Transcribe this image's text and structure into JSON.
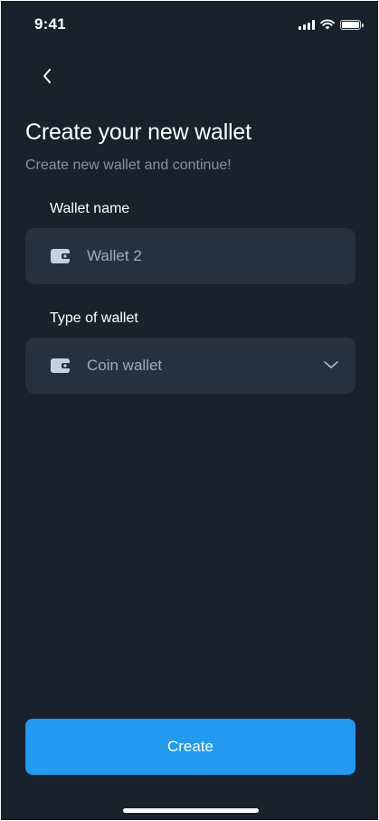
{
  "status_bar": {
    "time": "9:41"
  },
  "header": {
    "title": "Create your new wallet",
    "subtitle": "Create new wallet and continue!"
  },
  "form": {
    "wallet_name": {
      "label": "Wallet name",
      "value": "Wallet 2",
      "icon": "wallet-icon"
    },
    "wallet_type": {
      "label": "Type of wallet",
      "selected": "Coin wallet",
      "icon": "wallet-icon"
    }
  },
  "actions": {
    "create_label": "Create"
  },
  "colors": {
    "background": "#18212c",
    "field": "#25313f",
    "accent": "#219af0",
    "muted_text": "#7f93a8"
  }
}
